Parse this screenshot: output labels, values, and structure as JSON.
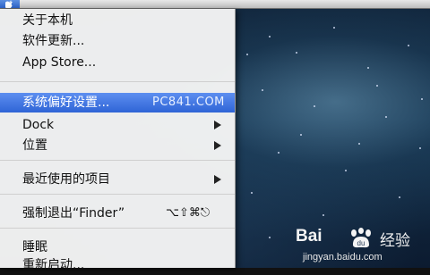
{
  "menubar": {
    "items": [
      "",
      "",
      "",
      "",
      "",
      ""
    ]
  },
  "apple_menu": {
    "items": [
      {
        "label": "关于本机"
      },
      {
        "label": "软件更新..."
      },
      {
        "label": "App Store..."
      },
      {
        "label": "系统偏好设置...",
        "selected": true
      },
      {
        "label": "Dock",
        "submenu": true
      },
      {
        "label": "位置",
        "submenu": true
      },
      {
        "label": "最近使用的项目",
        "submenu": true
      },
      {
        "label": "强制退出“Finder”",
        "shortcut": "⌥⇧⌘⎋"
      },
      {
        "label": "睡眠"
      },
      {
        "label": "重新启动..."
      }
    ]
  },
  "watermarks": {
    "site": "PC841.COM",
    "baidu_logo": "Bai",
    "baidu_cn": "经验",
    "baidu_url": "jingyan.baidu.com"
  },
  "colors": {
    "highlight": "#3a6fdc",
    "menu_bg": "#f4f4f4"
  }
}
